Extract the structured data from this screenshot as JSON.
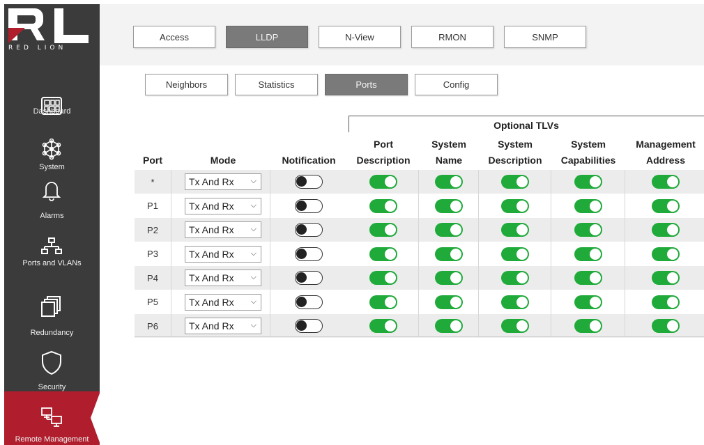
{
  "brand": {
    "logo_text": "RED LION",
    "accent": "#b01e2e"
  },
  "sidebar": {
    "items": [
      {
        "label": "Dashboard",
        "icon": "dashboard-icon",
        "active": false
      },
      {
        "label": "System",
        "icon": "system-icon",
        "active": false
      },
      {
        "label": "Alarms",
        "icon": "bell-icon",
        "active": false
      },
      {
        "label": "Ports and VLANs",
        "icon": "network-icon",
        "active": false
      },
      {
        "label": "Redundancy",
        "icon": "redundancy-icon",
        "active": false
      },
      {
        "label": "Security",
        "icon": "shield-icon",
        "active": false
      },
      {
        "label": "Remote Management",
        "icon": "remote-management-icon",
        "active": true
      }
    ]
  },
  "top_tabs": [
    {
      "label": "Access",
      "active": false
    },
    {
      "label": "LLDP",
      "active": true
    },
    {
      "label": "N-View",
      "active": false
    },
    {
      "label": "RMON",
      "active": false
    },
    {
      "label": "SNMP",
      "active": false
    }
  ],
  "sub_tabs": [
    {
      "label": "Neighbors",
      "active": false
    },
    {
      "label": "Statistics",
      "active": false
    },
    {
      "label": "Ports",
      "active": true
    },
    {
      "label": "Config",
      "active": false
    }
  ],
  "table": {
    "group_title": "Optional TLVs",
    "headers": {
      "port": "Port",
      "mode": "Mode",
      "notification": "Notification",
      "port_description": [
        "Port",
        "Description"
      ],
      "system_name": [
        "System",
        "Name"
      ],
      "system_description": [
        "System",
        "Description"
      ],
      "system_capabilities": [
        "System",
        "Capabilities"
      ],
      "management_address": [
        "Management",
        "Address"
      ]
    },
    "rows": [
      {
        "port": "*",
        "mode": "Tx And Rx",
        "notification": false,
        "port_description": true,
        "system_name": true,
        "system_description": true,
        "system_capabilities": true,
        "management_address": true
      },
      {
        "port": "P1",
        "mode": "Tx And Rx",
        "notification": false,
        "port_description": true,
        "system_name": true,
        "system_description": true,
        "system_capabilities": true,
        "management_address": true
      },
      {
        "port": "P2",
        "mode": "Tx And Rx",
        "notification": false,
        "port_description": true,
        "system_name": true,
        "system_description": true,
        "system_capabilities": true,
        "management_address": true
      },
      {
        "port": "P3",
        "mode": "Tx And Rx",
        "notification": false,
        "port_description": true,
        "system_name": true,
        "system_description": true,
        "system_capabilities": true,
        "management_address": true
      },
      {
        "port": "P4",
        "mode": "Tx And Rx",
        "notification": false,
        "port_description": true,
        "system_name": true,
        "system_description": true,
        "system_capabilities": true,
        "management_address": true
      },
      {
        "port": "P5",
        "mode": "Tx And Rx",
        "notification": false,
        "port_description": true,
        "system_name": true,
        "system_description": true,
        "system_capabilities": true,
        "management_address": true
      },
      {
        "port": "P6",
        "mode": "Tx And Rx",
        "notification": false,
        "port_description": true,
        "system_name": true,
        "system_description": true,
        "system_capabilities": true,
        "management_address": true
      }
    ]
  },
  "colors": {
    "toggle_on": "#1faa3a",
    "tab_active": "#7a7a7a",
    "sidebar_bg": "#3b3b3b"
  }
}
